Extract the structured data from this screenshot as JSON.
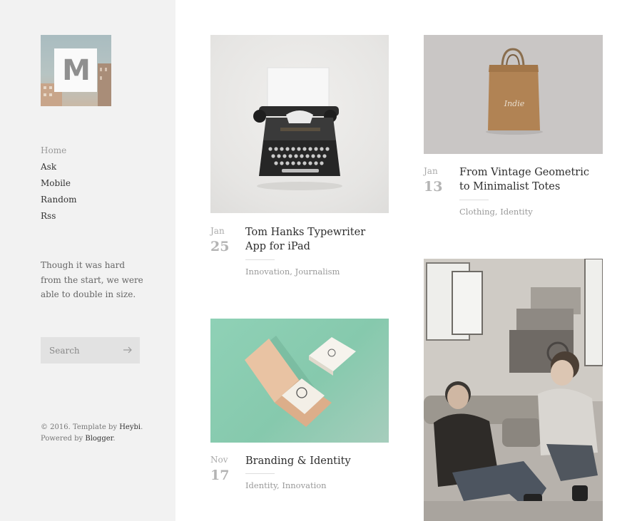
{
  "logo": {
    "letter": "M"
  },
  "nav": [
    "Home",
    "Ask",
    "Mobile",
    "Random",
    "Rss"
  ],
  "description": "Though it was hard from the start, we were able to double in size.",
  "search": {
    "placeholder": "Search"
  },
  "footer": {
    "line1_prefix": "© 2016. Template by ",
    "line1_link": "Heybi",
    "line1_suffix": ".",
    "line2_prefix": "Powered by ",
    "line2_link": "Blogger",
    "line2_suffix": "."
  },
  "posts": [
    {
      "month": "Jan",
      "day": "25",
      "title": "Tom Hanks Typewriter App for iPad",
      "tags": [
        "Innovation",
        "Journalism"
      ],
      "image": "typewriter"
    },
    {
      "month": "Jan",
      "day": "13",
      "title": "From Vintage Geometric to Minimalist Totes",
      "tags": [
        "Clothing",
        "Identity"
      ],
      "image": "tote-bag"
    },
    {
      "month": "Nov",
      "day": "17",
      "title": "Branding & Identity",
      "tags": [
        "Identity",
        "Innovation"
      ],
      "image": "business-cards"
    },
    {
      "month": "",
      "day": "",
      "title": "",
      "tags": [],
      "image": "couple-on-sofa"
    }
  ],
  "colors": {
    "sidebar_bg": "#f2f2f2",
    "search_bg": "#e2e2e2",
    "teal_bg": "#8dcfb2",
    "tote_bg": "#c9c6c5"
  }
}
